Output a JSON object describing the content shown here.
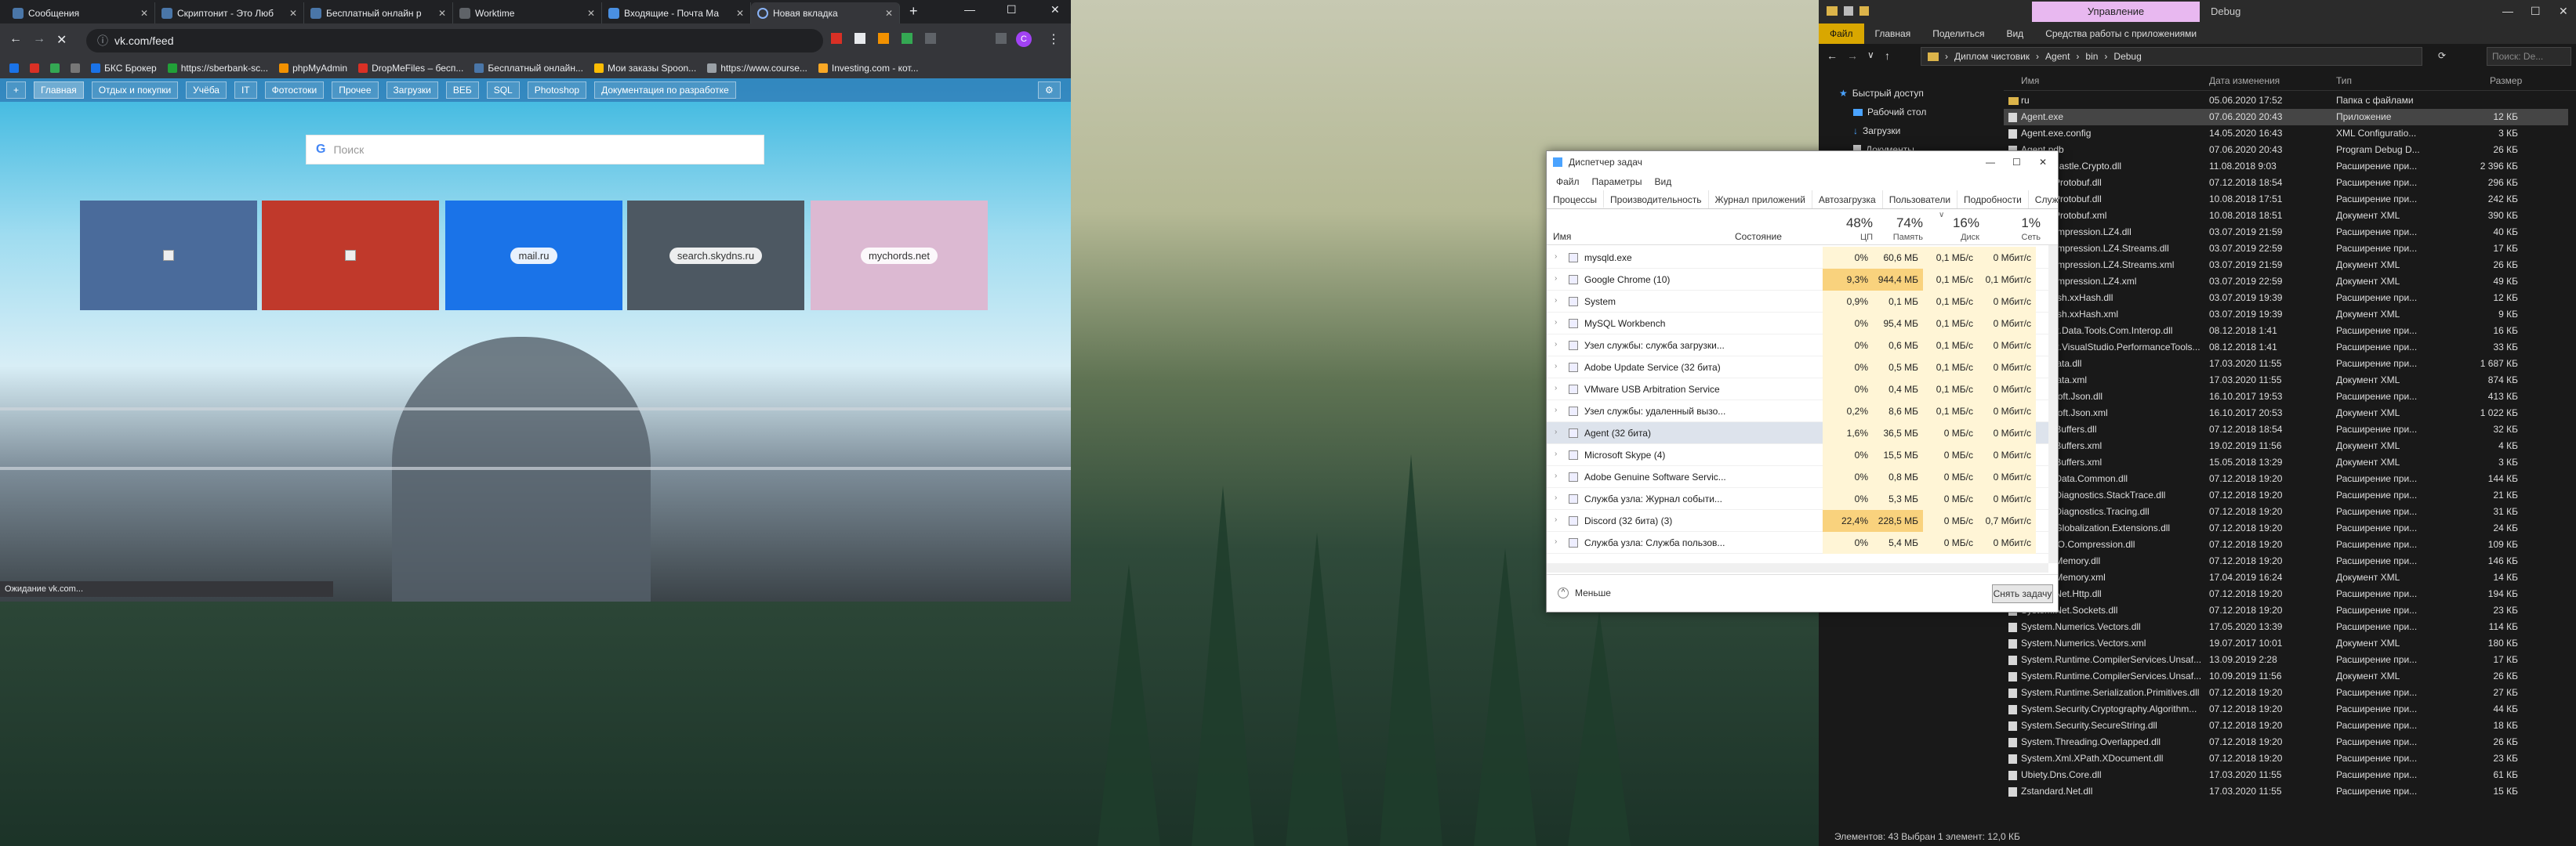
{
  "chrome": {
    "tabs": [
      {
        "label": "Сообщения",
        "color": "#4a76a8"
      },
      {
        "label": "Скриптонит - Это Люб",
        "color": "#4a76a8"
      },
      {
        "label": "Бесплатный онлайн р",
        "color": "#4a76a8"
      },
      {
        "label": "Worktime",
        "color": "#5f6368"
      },
      {
        "label": "Входящие - Почта Ма",
        "color": "#4a90e2"
      },
      {
        "label": "Новая вкладка",
        "color": "#5f6368"
      }
    ],
    "new_tab": "+",
    "window_controls": {
      "min": "—",
      "max": "☐",
      "close": "✕"
    },
    "url": "vk.com/feed",
    "bookmarks": [
      {
        "label": "БКС Брокер",
        "color": "#1a73e8"
      },
      {
        "label": "https://sberbank-sc...",
        "color": "#21a038"
      },
      {
        "label": "phpMyAdmin",
        "color": "#f29100"
      },
      {
        "label": "DropMeFiles – бесп...",
        "color": "#d93025"
      },
      {
        "label": "Бесплатный онлайн...",
        "color": "#4a76a8"
      },
      {
        "label": "Мои заказы Spoon...",
        "color": "#fbbc04"
      },
      {
        "label": "https://www.course...",
        "color": "#9aa0a6"
      },
      {
        "label": "Investing.com - кот...",
        "color": "#f9a825"
      }
    ],
    "vk_nav": [
      {
        "label": "Главная"
      },
      {
        "label": "Отдых и покупки"
      },
      {
        "label": "Учёба"
      },
      {
        "label": "IT"
      },
      {
        "label": "Фотостоки"
      },
      {
        "label": "Прочее"
      },
      {
        "label": "Загрузки"
      },
      {
        "label": "BEБ"
      },
      {
        "label": "SQL"
      },
      {
        "label": "Photoshop"
      },
      {
        "label": "Документация по разработке"
      }
    ],
    "search_placeholder": "Поиск",
    "google_letter": "G",
    "tiles": [
      {
        "label": "",
        "color": "#4a6b9b"
      },
      {
        "label": "",
        "color": "#c0392b"
      },
      {
        "label": "mail.ru",
        "color": "#1a73e8"
      },
      {
        "label": "search.skydns.ru",
        "color": "#4d5862"
      },
      {
        "label": "mychords.net",
        "color": "#dcb9d2"
      }
    ],
    "status": "Ожидание vk.com..."
  },
  "taskmgr": {
    "title": "Диспетчер задач",
    "menu": [
      "Файл",
      "Параметры",
      "Вид"
    ],
    "tabs": [
      "Процессы",
      "Производительность",
      "Журнал приложений",
      "Автозагрузка",
      "Пользователи",
      "Подробности",
      "Службы"
    ],
    "headers": {
      "name": "Имя",
      "state": "Состояние",
      "cpu_pct": "48%",
      "cpu": "ЦП",
      "mem_pct": "74%",
      "mem": "Память",
      "disk_pct": "16%",
      "disk": "Диск",
      "net_pct": "1%",
      "net": "Сеть"
    },
    "processes": [
      {
        "name": "mysqld.exe",
        "cpu": "0%",
        "mem": "60,6 МБ",
        "disk": "0,1 МБ/с",
        "net": "0 Мбит/с",
        "hot": false
      },
      {
        "name": "Google Chrome (10)",
        "cpu": "9,3%",
        "mem": "944,4 МБ",
        "disk": "0,1 МБ/с",
        "net": "0,1 Мбит/с",
        "hot": true
      },
      {
        "name": "System",
        "cpu": "0,9%",
        "mem": "0,1 МБ",
        "disk": "0,1 МБ/с",
        "net": "0 Мбит/с",
        "hot": false
      },
      {
        "name": "MySQL Workbench",
        "cpu": "0%",
        "mem": "95,4 МБ",
        "disk": "0,1 МБ/с",
        "net": "0 Мбит/с",
        "hot": false
      },
      {
        "name": "Узел службы: служба загрузки...",
        "cpu": "0%",
        "mem": "0,6 МБ",
        "disk": "0,1 МБ/с",
        "net": "0 Мбит/с",
        "hot": false
      },
      {
        "name": "Adobe Update Service (32 бита)",
        "cpu": "0%",
        "mem": "0,5 МБ",
        "disk": "0,1 МБ/с",
        "net": "0 Мбит/с",
        "hot": false
      },
      {
        "name": "VMware USB Arbitration Service",
        "cpu": "0%",
        "mem": "0,4 МБ",
        "disk": "0,1 МБ/с",
        "net": "0 Мбит/с",
        "hot": false
      },
      {
        "name": "Узел службы: удаленный вызо...",
        "cpu": "0,2%",
        "mem": "8,6 МБ",
        "disk": "0,1 МБ/с",
        "net": "0 Мбит/с",
        "hot": false
      },
      {
        "name": "Agent (32 бита)",
        "cpu": "1,6%",
        "mem": "36,5 МБ",
        "disk": "0 МБ/с",
        "net": "0 Мбит/с",
        "hot": false
      },
      {
        "name": "Microsoft Skype (4)",
        "cpu": "0%",
        "mem": "15,5 МБ",
        "disk": "0 МБ/с",
        "net": "0 Мбит/с",
        "hot": false
      },
      {
        "name": "Adobe Genuine Software Servic...",
        "cpu": "0%",
        "mem": "0,8 МБ",
        "disk": "0 МБ/с",
        "net": "0 Мбит/с",
        "hot": false
      },
      {
        "name": "Служба узла: Журнал событи...",
        "cpu": "0%",
        "mem": "5,3 МБ",
        "disk": "0 МБ/с",
        "net": "0 Мбит/с",
        "hot": false
      },
      {
        "name": "Discord (32 бита) (3)",
        "cpu": "22,4%",
        "mem": "228,5 МБ",
        "disk": "0 МБ/с",
        "net": "0,7 Мбит/с",
        "hot": true
      },
      {
        "name": "Служба узла: Служба пользов...",
        "cpu": "0%",
        "mem": "5,4 МБ",
        "disk": "0 МБ/с",
        "net": "0 Мбит/с",
        "hot": false
      }
    ],
    "less": "Меньше",
    "end_task": "Снять задачу"
  },
  "explorer": {
    "manage_tab": "Управление",
    "title": "Debug",
    "ribbon": [
      "Файл",
      "Главная",
      "Поделиться",
      "Вид",
      "Средства работы с приложениями"
    ],
    "path": [
      "Диплом чистовик",
      "Agent",
      "bin",
      "Debug"
    ],
    "search": "Поиск: De...",
    "nav": [
      "Быстрый доступ",
      "Рабочий стол",
      "Загрузки",
      "Документы"
    ],
    "columns": {
      "name": "Имя",
      "date": "Дата изменения",
      "type": "Тип",
      "size": "Размер"
    },
    "files": [
      {
        "name": "ru",
        "date": "05.06.2020 17:52",
        "type": "Папка с файлами",
        "size": "",
        "folder": true
      },
      {
        "name": "Agent.exe",
        "date": "07.06.2020 20:43",
        "type": "Приложение",
        "size": "12 КБ",
        "sel": true
      },
      {
        "name": "Agent.exe.config",
        "date": "14.05.2020 16:43",
        "type": "XML Configuratio...",
        "size": "3 КБ"
      },
      {
        "name": "Agent.pdb",
        "date": "07.06.2020 20:43",
        "type": "Program Debug D...",
        "size": "26 КБ"
      },
      {
        "name": "BouncyCastle.Crypto.dll",
        "date": "11.08.2018 9:03",
        "type": "Расширение при...",
        "size": "2 396 КБ"
      },
      {
        "name": "Google.Protobuf.dll",
        "date": "07.12.2018 18:54",
        "type": "Расширение при...",
        "size": "296 КБ"
      },
      {
        "name": "Google.Protobuf.dll",
        "date": "10.08.2018 17:51",
        "type": "Расширение при...",
        "size": "242 КБ"
      },
      {
        "name": "Google.Protobuf.xml",
        "date": "10.08.2018 18:51",
        "type": "Документ XML",
        "size": "390 КБ"
      },
      {
        "name": "K4os.Compression.LZ4.dll",
        "date": "03.07.2019 21:59",
        "type": "Расширение при...",
        "size": "40 КБ"
      },
      {
        "name": "K4os.Compression.LZ4.Streams.dll",
        "date": "03.07.2019 22:59",
        "type": "Расширение при...",
        "size": "17 КБ"
      },
      {
        "name": "K4os.Compression.LZ4.Streams.xml",
        "date": "03.07.2019 21:59",
        "type": "Документ XML",
        "size": "26 КБ"
      },
      {
        "name": "K4os.Compression.LZ4.xml",
        "date": "03.07.2019 22:59",
        "type": "Документ XML",
        "size": "49 КБ"
      },
      {
        "name": "K4os.Hash.xxHash.dll",
        "date": "03.07.2019 19:39",
        "type": "Расширение при...",
        "size": "12 КБ"
      },
      {
        "name": "K4os.Hash.xxHash.xml",
        "date": "03.07.2019 19:39",
        "type": "Документ XML",
        "size": "9 КБ"
      },
      {
        "name": "Microsoft.Data.Tools.Com.Interop.dll",
        "date": "08.12.2018 1:41",
        "type": "Расширение при...",
        "size": "16 КБ"
      },
      {
        "name": "Microsoft.VisualStudio.PerformanceTools...",
        "date": "08.12.2018 1:41",
        "type": "Расширение при...",
        "size": "33 КБ"
      },
      {
        "name": "MySql.Data.dll",
        "date": "17.03.2020 11:55",
        "type": "Расширение при...",
        "size": "1 687 КБ"
      },
      {
        "name": "MySql.Data.xml",
        "date": "17.03.2020 11:55",
        "type": "Документ XML",
        "size": "874 КБ"
      },
      {
        "name": "Newtonsoft.Json.dll",
        "date": "16.10.2017 19:53",
        "type": "Расширение при...",
        "size": "413 КБ"
      },
      {
        "name": "Newtonsoft.Json.xml",
        "date": "16.10.2017 20:53",
        "type": "Документ XML",
        "size": "1 022 КБ"
      },
      {
        "name": "System.Buffers.dll",
        "date": "07.12.2018 18:54",
        "type": "Расширение при...",
        "size": "32 КБ"
      },
      {
        "name": "System.Buffers.xml",
        "date": "19.02.2019 11:56",
        "type": "Документ XML",
        "size": "4 КБ"
      },
      {
        "name": "System.Buffers.xml",
        "date": "15.05.2018 13:29",
        "type": "Документ XML",
        "size": "3 КБ"
      },
      {
        "name": "System.Data.Common.dll",
        "date": "07.12.2018 19:20",
        "type": "Расширение при...",
        "size": "144 КБ"
      },
      {
        "name": "System.Diagnostics.StackTrace.dll",
        "date": "07.12.2018 19:20",
        "type": "Расширение при...",
        "size": "21 КБ"
      },
      {
        "name": "System.Diagnostics.Tracing.dll",
        "date": "07.12.2018 19:20",
        "type": "Расширение при...",
        "size": "31 КБ"
      },
      {
        "name": "System.Globalization.Extensions.dll",
        "date": "07.12.2018 19:20",
        "type": "Расширение при...",
        "size": "24 КБ"
      },
      {
        "name": "System.IO.Compression.dll",
        "date": "07.12.2018 19:20",
        "type": "Расширение при...",
        "size": "109 КБ"
      },
      {
        "name": "System.Memory.dll",
        "date": "07.12.2018 19:20",
        "type": "Расширение при...",
        "size": "146 КБ"
      },
      {
        "name": "System.Memory.xml",
        "date": "17.04.2019 16:24",
        "type": "Документ XML",
        "size": "14 КБ"
      },
      {
        "name": "System.Net.Http.dll",
        "date": "07.12.2018 19:20",
        "type": "Расширение при...",
        "size": "194 КБ"
      },
      {
        "name": "System.Net.Sockets.dll",
        "date": "07.12.2018 19:20",
        "type": "Расширение при...",
        "size": "23 КБ"
      },
      {
        "name": "System.Numerics.Vectors.dll",
        "date": "17.05.2020 13:39",
        "type": "Расширение при...",
        "size": "114 КБ"
      },
      {
        "name": "System.Numerics.Vectors.xml",
        "date": "19.07.2017 10:01",
        "type": "Документ XML",
        "size": "180 КБ"
      },
      {
        "name": "System.Runtime.CompilerServices.Unsaf...",
        "date": "13.09.2019 2:28",
        "type": "Расширение при...",
        "size": "17 КБ"
      },
      {
        "name": "System.Runtime.CompilerServices.Unsaf...",
        "date": "10.09.2019 11:56",
        "type": "Документ XML",
        "size": "26 КБ"
      },
      {
        "name": "System.Runtime.Serialization.Primitives.dll",
        "date": "07.12.2018 19:20",
        "type": "Расширение при...",
        "size": "27 КБ"
      },
      {
        "name": "System.Security.Cryptography.Algorithm...",
        "date": "07.12.2018 19:20",
        "type": "Расширение при...",
        "size": "44 КБ"
      },
      {
        "name": "System.Security.SecureString.dll",
        "date": "07.12.2018 19:20",
        "type": "Расширение при...",
        "size": "18 КБ"
      },
      {
        "name": "System.Threading.Overlapped.dll",
        "date": "07.12.2018 19:20",
        "type": "Расширение при...",
        "size": "26 КБ"
      },
      {
        "name": "System.Xml.XPath.XDocument.dll",
        "date": "07.12.2018 19:20",
        "type": "Расширение при...",
        "size": "23 КБ"
      },
      {
        "name": "Ubiety.Dns.Core.dll",
        "date": "17.03.2020 11:55",
        "type": "Расширение при...",
        "size": "61 КБ"
      },
      {
        "name": "Zstandard.Net.dll",
        "date": "17.03.2020 11:55",
        "type": "Расширение при...",
        "size": "15 КБ"
      }
    ],
    "status": "Элементов: 43    Выбран 1 элемент: 12,0 КБ"
  }
}
